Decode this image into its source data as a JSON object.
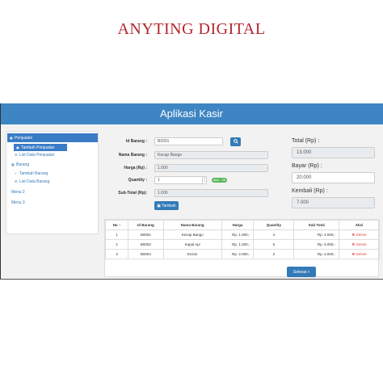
{
  "brand": {
    "title": "ANYTING DIGITAL"
  },
  "app": {
    "header_title": "Aplikasi Kasir"
  },
  "sidebar": {
    "items": [
      {
        "label": "Penjualan",
        "icon": "cart-icon"
      },
      {
        "label": "Tambah Penjualan",
        "icon": "cart-icon"
      },
      {
        "label": "List Data Penjualan",
        "icon": "list-icon"
      },
      {
        "label": "Barang",
        "icon": "cubes-icon"
      },
      {
        "label": "Tambah Barang",
        "icon": "plus-icon"
      },
      {
        "label": "List Data Barang",
        "icon": "list-icon"
      },
      {
        "label": "Menu 2"
      },
      {
        "label": "Menu 3"
      }
    ]
  },
  "form": {
    "id_barang_label": "Id Barang :",
    "id_barang_value": "B0001",
    "nama_barang_label": "Nama Barang :",
    "nama_barang_value": "Kecap Bango",
    "harga_label": "Harga (Rp) :",
    "harga_value": "1.000",
    "quantity_label": "Quantity :",
    "quantity_value": "1",
    "stock_badge": "stok : 26",
    "subtotal_label": "Sub-Total (Rp):",
    "subtotal_value": "1.000",
    "tambah_label": "Tambah",
    "search_icon": "search-icon"
  },
  "totals": {
    "total_label": "Total (Rp) :",
    "total_value": "13.000",
    "bayar_label": "Bayar (Rp) :",
    "bayar_value": "20.000",
    "kembali_label": "Kembali (Rp) :",
    "kembali_value": "7.000"
  },
  "table": {
    "headers": [
      "No",
      "Id Barang",
      "Nama Barang",
      "Harga",
      "Quantity",
      "Sub Total",
      "Aksi"
    ],
    "sort_indicator": "↕",
    "rows": [
      {
        "no": "1",
        "id": "B0001",
        "nama": "Kecap Bango",
        "harga": "Rp. 1.000,-",
        "qty": "4",
        "subtotal": "Rp. 4.000,-",
        "aksi": "Delete"
      },
      {
        "no": "2",
        "id": "B0002",
        "nama": "Kapal Api",
        "harga": "Rp. 1.000,-",
        "qty": "5",
        "subtotal": "Rp. 5.000,-",
        "aksi": "Delete"
      },
      {
        "no": "3",
        "id": "B0004",
        "nama": "Enzim",
        "harga": "Rp. 2.000,-",
        "qty": "2",
        "subtotal": "Rp. 4.000,-",
        "aksi": "Delete"
      }
    ]
  },
  "actions": {
    "selesai_label": "Selesai"
  },
  "colors": {
    "brand": "#b3262e",
    "header": "#3d85c3",
    "primary": "#337ab7",
    "success": "#5cb85c",
    "danger": "#d9534f"
  }
}
